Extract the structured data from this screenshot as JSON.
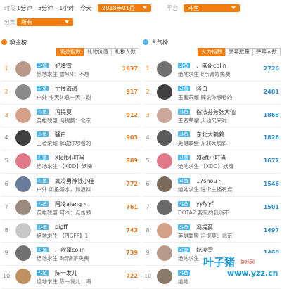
{
  "filters": {
    "time_label": "时段",
    "time_options": [
      "1分钟",
      "5分钟",
      "1小时",
      "今天"
    ],
    "month_value": "2018年01月",
    "platform_label": "平台",
    "platform_value": "斗鱼",
    "category_label": "分类",
    "category_value": "所有"
  },
  "gift_board": {
    "title": "吸金榜",
    "tabs": [
      "吸金指数",
      "礼物价值",
      "礼物人数"
    ],
    "active_tab": 0,
    "rows": [
      {
        "rank": "1",
        "tag": "斗鱼",
        "name": "妃凌雪",
        "desc": "绝地求生 雪MM：不想",
        "value": "1637",
        "avatar_color": "#b99a8a"
      },
      {
        "rank": "2",
        "tag": "斗鱼",
        "name": "主播海涛",
        "desc": "户外 今天休息一天！谢",
        "value": "917",
        "avatar_color": "#8a8a8a"
      },
      {
        "rank": "3",
        "tag": "斗鱼",
        "name": "冯提莫",
        "desc": "英雄联盟 冯提莫：北京",
        "value": "912",
        "avatar_color": "#d4a088"
      },
      {
        "rank": "4",
        "tag": "斗鱼",
        "name": "骚白",
        "desc": "王者荣耀 解说你想看的",
        "value": "903",
        "avatar_color": "#404040"
      },
      {
        "rank": "5",
        "tag": "斗鱼",
        "name": "Xleft小叮当",
        "desc": "绝地求生 【XDD】妖嗨",
        "value": "889",
        "avatar_color": "#e07a8a"
      },
      {
        "rank": "6",
        "tag": "斗鱼",
        "name": "高冷男神钱小佳",
        "desc": "户外 如鱼得水，如狼似",
        "value": "772",
        "avatar_color": "#6a7a9a"
      },
      {
        "rank": "7",
        "tag": "斗鱼",
        "name": "阿冷aleng丶",
        "desc": "英雄联盟 阿冷：点击领",
        "value": "761",
        "avatar_color": "#9a8a80"
      },
      {
        "rank": "8",
        "tag": "斗鱼",
        "name": "pigff",
        "desc": "绝地求生 【PIGFF】1",
        "value": "743",
        "avatar_color": "#c8c8c8"
      },
      {
        "rank": "9",
        "tag": "斗鱼",
        "name": "、歆哥colin",
        "desc": "绝地求生 8点肾筹免费",
        "value": "739",
        "avatar_color": "#707070"
      },
      {
        "rank": "10",
        "tag": "斗鱼",
        "name": "陈一发儿",
        "desc": "绝地求生 陈一发儿：喝",
        "value": "722",
        "avatar_color": "#c09060"
      }
    ]
  },
  "popularity_board": {
    "title": "人气榜",
    "tabs": [
      "火力指数",
      "弹幕数量",
      "弹幕人数"
    ],
    "active_tab": 0,
    "rows": [
      {
        "rank": "1",
        "tag": "斗鱼",
        "name": "、歆哥colin",
        "desc": "绝地求生 8点肾筹免费",
        "value": "2726",
        "avatar_color": "#707070"
      },
      {
        "rank": "2",
        "tag": "斗鱼",
        "name": "骚白",
        "desc": "王者荣耀 解说你想看的",
        "value": "2401",
        "avatar_color": "#404040"
      },
      {
        "rank": "3",
        "tag": "斗鱼",
        "name": "指法芬芳张大仙",
        "desc": "王者荣耀 大仙又来啦",
        "value": "1868",
        "avatar_color": "#caa79a"
      },
      {
        "rank": "4",
        "tag": "斗鱼",
        "name": "东北大鹌鹑",
        "desc": "英雄联盟 东北大鹌鹑",
        "value": "1826",
        "avatar_color": "#5a5a5a"
      },
      {
        "rank": "5",
        "tag": "斗鱼",
        "name": "Xleft小叮当",
        "desc": "绝地求生 【XDD】妖嗨",
        "value": "1677",
        "avatar_color": "#e07a8a"
      },
      {
        "rank": "6",
        "tag": "斗鱼",
        "name": "17shou丶",
        "desc": "绝地求生 这个主播有点",
        "value": "1546",
        "avatar_color": "#7a6a5a"
      },
      {
        "rank": "7",
        "tag": "斗鱼",
        "name": "yyfyyf",
        "desc": "DOTA2 我玩的我嗨不",
        "value": "1501",
        "avatar_color": "#6a6a6a"
      },
      {
        "rank": "8",
        "tag": "斗鱼",
        "name": "冯提莫",
        "desc": "英雄联盟 冯提莫：北京",
        "value": "1497",
        "avatar_color": "#d4a088"
      },
      {
        "rank": "9",
        "tag": "斗鱼",
        "name": "妃凌雪",
        "desc": "绝地求生 雪MM：不想",
        "value": "1460",
        "avatar_color": "#b99a8a"
      },
      {
        "rank": "10",
        "tag": "斗鱼",
        "name": "",
        "desc": "绝地",
        "value": "",
        "avatar_color": "#8a7a6a"
      }
    ]
  },
  "watermark": {
    "main": "叶子猪",
    "sub": "游戏网",
    "url": "www.yzz.cn"
  },
  "colors": {
    "accent_orange": "#f07d0e",
    "tag_blue": "#52b7e8",
    "value_orange": "#e5761b",
    "value_blue": "#2d8fd6",
    "gift_icon": "#f07d0e",
    "popularity_icon": "#52b7e8"
  }
}
